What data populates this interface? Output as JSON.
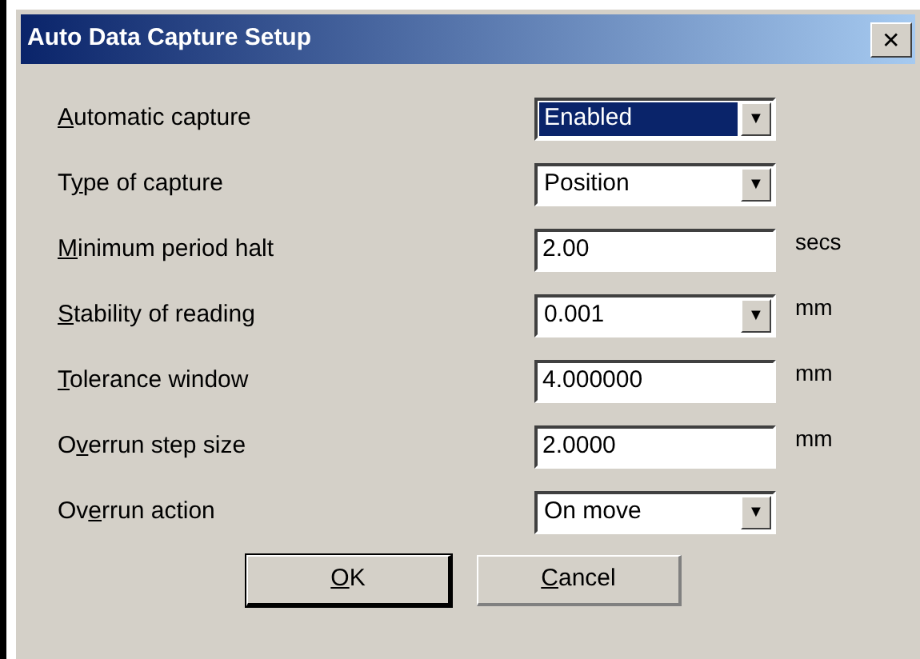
{
  "window": {
    "title": "Auto Data Capture Setup",
    "close": "✕"
  },
  "fields": [
    {
      "access_key": "A",
      "label_rest": "utomatic capture",
      "kind": "combo",
      "value": "Enabled",
      "focused": true,
      "arrow": "▼"
    },
    {
      "label_start": "T",
      "access_key": "y",
      "label_rest": "pe of capture",
      "kind": "combo",
      "value": "Position",
      "focused": false,
      "arrow": "▼"
    },
    {
      "access_key": "M",
      "label_rest": "inimum period halt",
      "kind": "text",
      "value": "2.00",
      "unit": "secs"
    },
    {
      "access_key": "S",
      "label_rest": "tability of reading",
      "kind": "combo",
      "value": "0.001",
      "focused": false,
      "arrow": "▼",
      "unit": "mm"
    },
    {
      "access_key": "T",
      "label_rest": "olerance window",
      "kind": "text",
      "value": "4.000000",
      "unit": "mm"
    },
    {
      "label_start": "O",
      "access_key": "v",
      "label_rest": "errun step size",
      "kind": "text",
      "value": "2.0000",
      "unit": "mm"
    },
    {
      "label_start": "Ov",
      "access_key": "e",
      "label_rest": "rrun action",
      "kind": "combo",
      "value": "On move",
      "focused": false,
      "arrow": "▼"
    }
  ],
  "buttons": [
    {
      "access_key": "O",
      "label_rest": "K",
      "default": true
    },
    {
      "access_key": "C",
      "label_rest": "ancel",
      "default": false
    }
  ]
}
